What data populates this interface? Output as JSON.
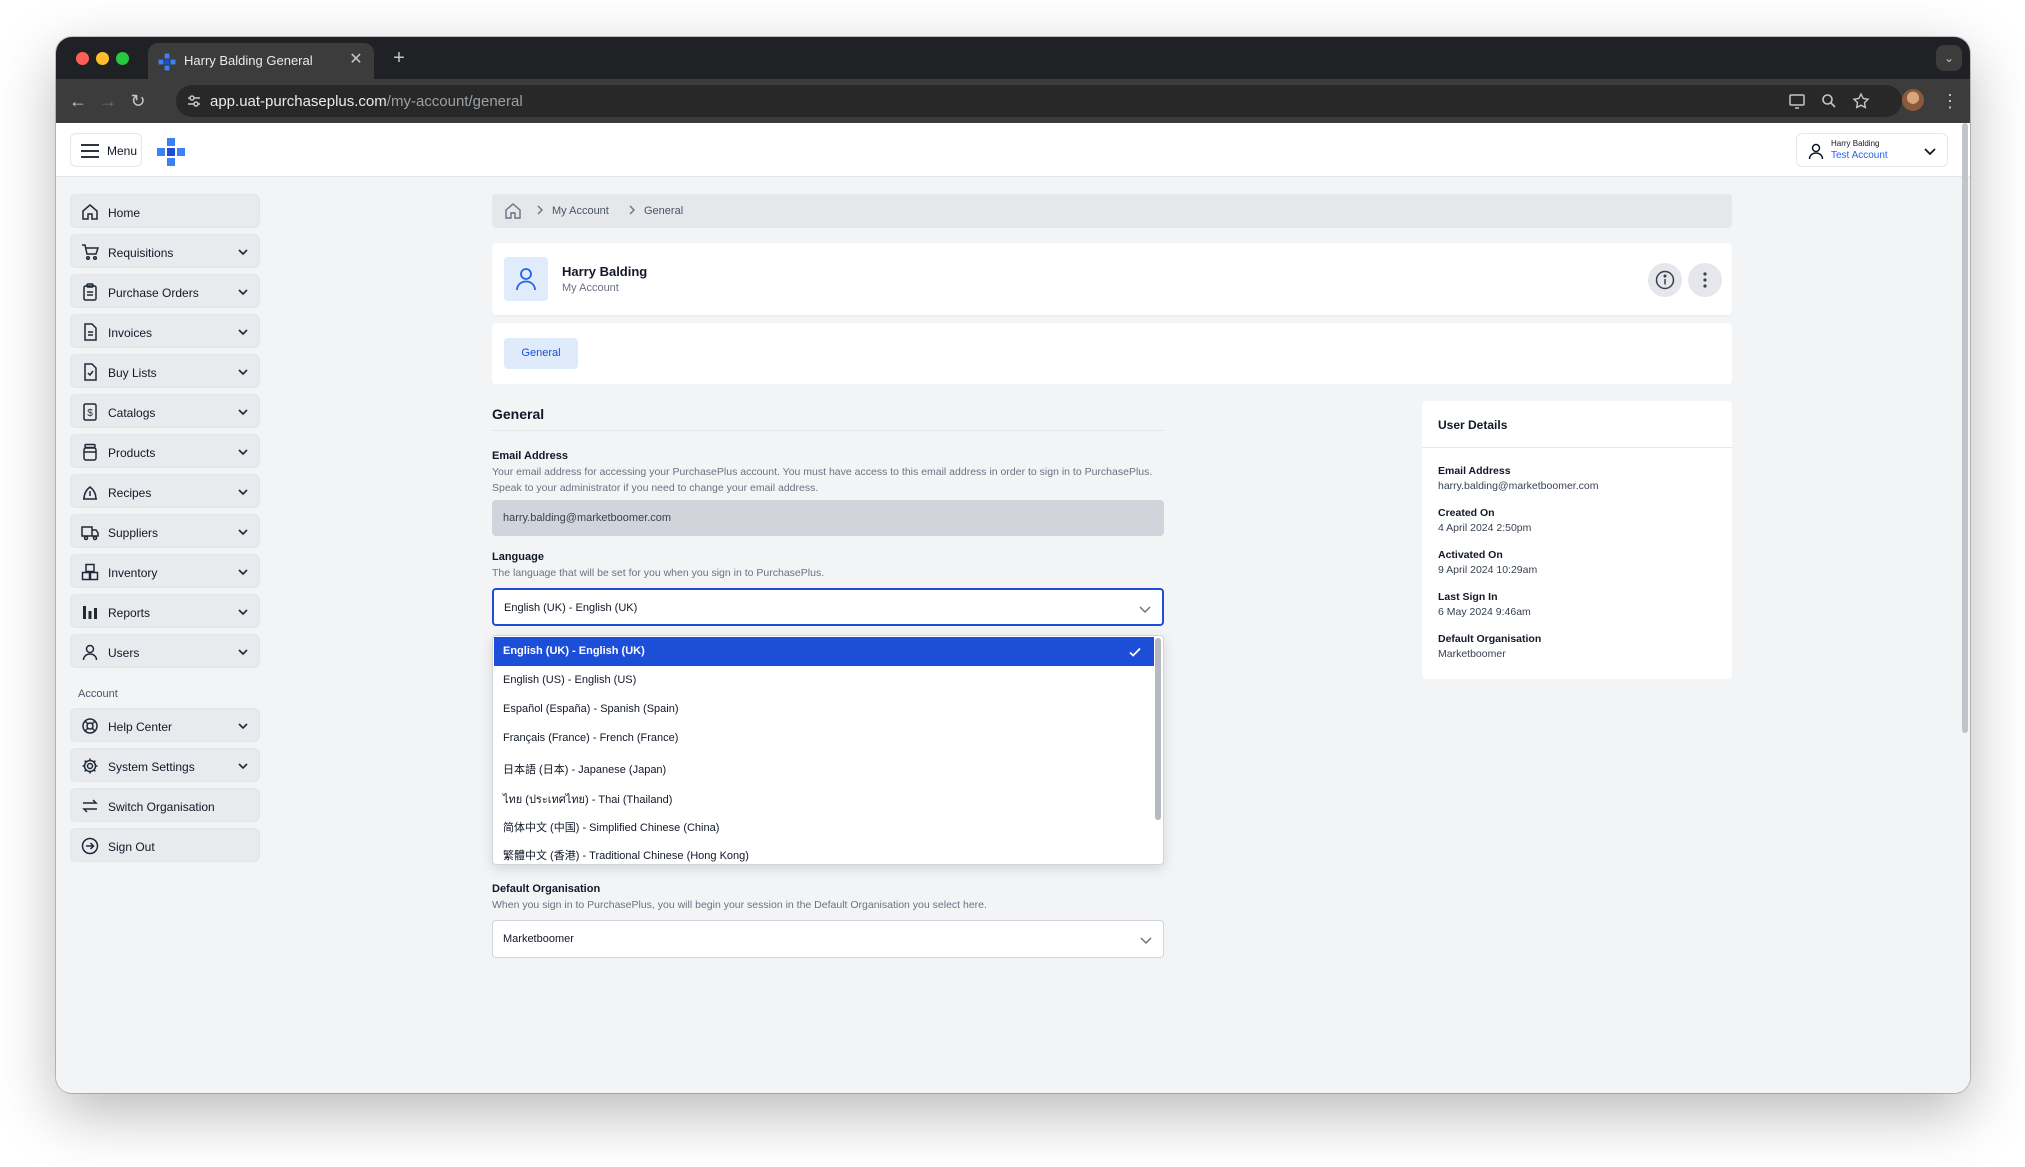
{
  "browser": {
    "tab_title": "Harry Balding General",
    "url_host": "app.uat-purchaseplus.com",
    "url_path": "/my-account/general"
  },
  "appbar": {
    "menu_label": "Menu",
    "user_name": "Harry Balding",
    "user_account": "Test Account"
  },
  "sidebar": {
    "items": [
      {
        "label": "Home",
        "icon": "home-icon",
        "expandable": false
      },
      {
        "label": "Requisitions",
        "icon": "cart-icon",
        "expandable": true
      },
      {
        "label": "Purchase Orders",
        "icon": "clipboard-icon",
        "expandable": true
      },
      {
        "label": "Invoices",
        "icon": "document-icon",
        "expandable": true
      },
      {
        "label": "Buy Lists",
        "icon": "checklist-icon",
        "expandable": true
      },
      {
        "label": "Catalogs",
        "icon": "dollar-document-icon",
        "expandable": true
      },
      {
        "label": "Products",
        "icon": "jar-icon",
        "expandable": true
      },
      {
        "label": "Recipes",
        "icon": "recipe-icon",
        "expandable": true
      },
      {
        "label": "Suppliers",
        "icon": "truck-icon",
        "expandable": true
      },
      {
        "label": "Inventory",
        "icon": "boxes-icon",
        "expandable": true
      },
      {
        "label": "Reports",
        "icon": "bar-chart-icon",
        "expandable": true
      },
      {
        "label": "Users",
        "icon": "user-icon",
        "expandable": true
      }
    ],
    "account_section_label": "Account",
    "account_items": [
      {
        "label": "Help Center",
        "icon": "lifebuoy-icon",
        "expandable": true
      },
      {
        "label": "System Settings",
        "icon": "gear-icon",
        "expandable": true
      },
      {
        "label": "Switch Organisation",
        "icon": "swap-icon",
        "expandable": false
      },
      {
        "label": "Sign Out",
        "icon": "sign-out-icon",
        "expandable": false
      }
    ]
  },
  "breadcrumb": {
    "items": [
      "My Account",
      "General"
    ]
  },
  "profile": {
    "name": "Harry Balding",
    "subtitle": "My Account"
  },
  "tabs": {
    "active": "General"
  },
  "general": {
    "title": "General",
    "email_label": "Email Address",
    "email_desc": "Your email address for accessing your PurchasePlus account. You must have access to this email address in order to sign in to PurchasePlus. Speak to your administrator if you need to change your email address.",
    "email_value": "harry.balding@marketboomer.com",
    "language_label": "Language",
    "language_desc": "The language that will be set for you when you sign in to PurchasePlus.",
    "language_value": "English (UK) - English (UK)",
    "language_options": [
      "English (UK) - English (UK)",
      "English (US) - English (US)",
      "Español (España) - Spanish (Spain)",
      "Français (France) - French (France)",
      "日本語 (日本) - Japanese (Japan)",
      "ไทย (ประเทศไทย) - Thai (Thailand)",
      "简体中文 (中国) - Simplified Chinese (China)",
      "繁體中文 (香港) - Traditional Chinese (Hong Kong)"
    ],
    "default_org_label": "Default Organisation",
    "default_org_desc": "When you sign in to PurchasePlus, you will begin your session in the Default Organisation you select here.",
    "default_org_value": "Marketboomer"
  },
  "user_details": {
    "title": "User Details",
    "rows": [
      {
        "label": "Email Address",
        "value": "harry.balding@marketboomer.com"
      },
      {
        "label": "Created On",
        "value": "4 April 2024 2:50pm"
      },
      {
        "label": "Activated On",
        "value": "9 April 2024 10:29am"
      },
      {
        "label": "Last Sign In",
        "value": "6 May 2024 9:46am"
      },
      {
        "label": "Default Organisation",
        "value": "Marketboomer"
      }
    ]
  },
  "colors": {
    "accent": "#1d4ed8",
    "brand": "#2563eb",
    "sidebar_bg": "#e9eaed",
    "page_bg": "#f3f4f6"
  }
}
